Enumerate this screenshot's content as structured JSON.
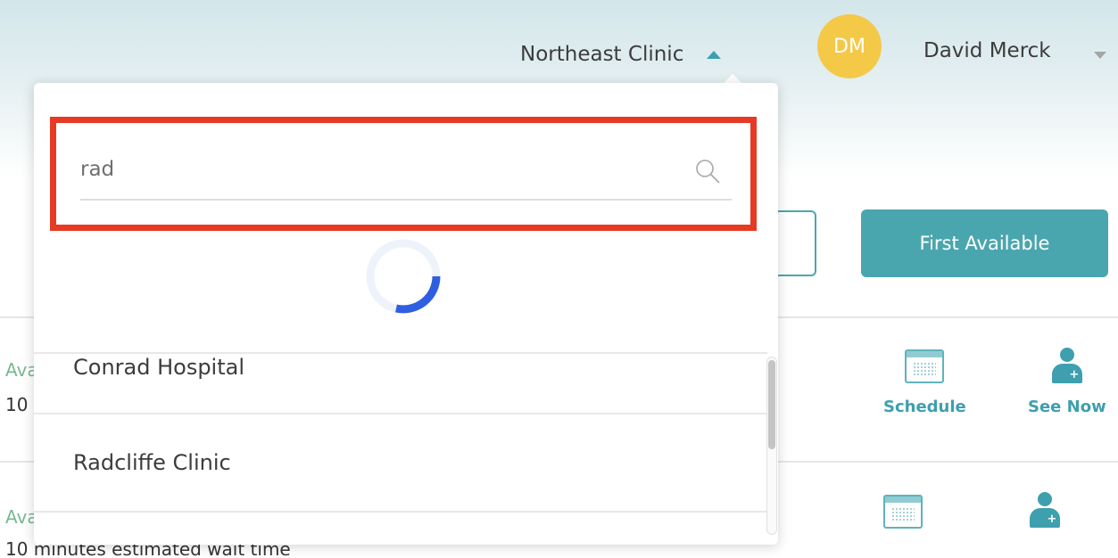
{
  "header": {
    "clinic_name": "Northeast Clinic",
    "avatar_initials": "DM",
    "user_name": "David Merck"
  },
  "buttons": {
    "first_available": "First Available"
  },
  "rows": [
    {
      "availability": "Ava",
      "wait": "10",
      "schedule_label": "Schedule",
      "see_now_label": "See Now"
    },
    {
      "availability": "Ava",
      "wait": "10 minutes estimated wait time"
    }
  ],
  "clinic_dropdown": {
    "search_value": "rad",
    "results": [
      "Conrad Hospital",
      "Radcliffe Clinic"
    ]
  },
  "colors": {
    "accent": "#4aa6ae",
    "avatar": "#f4c948",
    "highlight": "#e63a24",
    "spinner": "#2f5fe0"
  }
}
